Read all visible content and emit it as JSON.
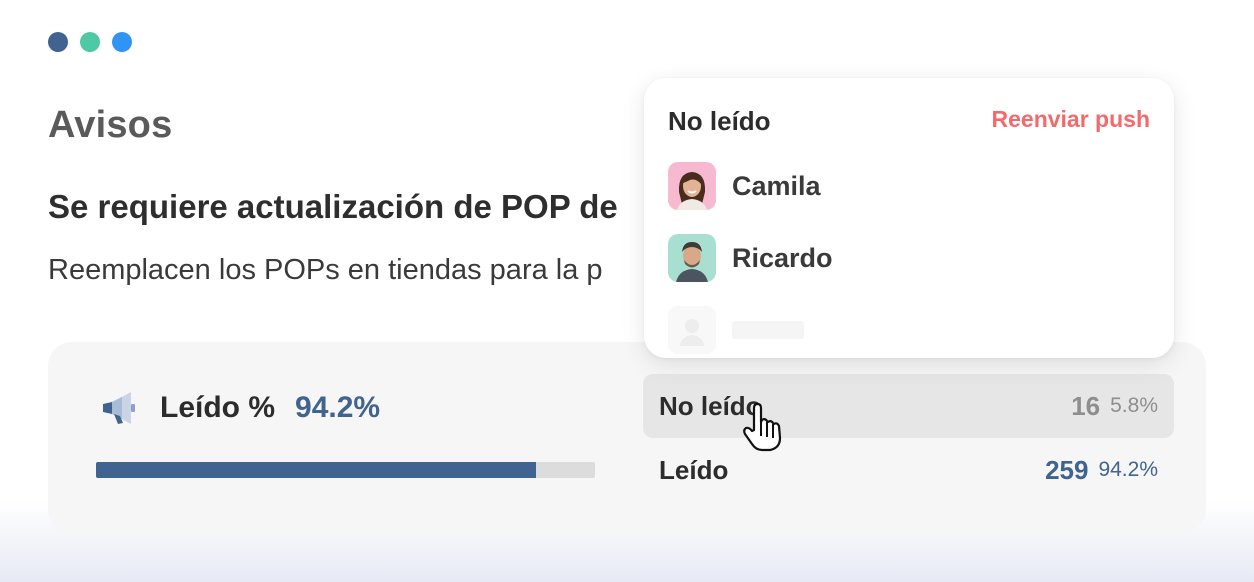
{
  "window": {
    "dot_colors": [
      "#41638f",
      "#4fc9a5",
      "#2f94f4"
    ]
  },
  "page": {
    "title": "Avisos",
    "headline": "Se requiere actualización de POP de",
    "subtitle": "Reemplacen los POPs en tiendas para la p"
  },
  "stats": {
    "icon": "megaphone-icon",
    "read_label": "Leído %",
    "read_percent_text": "94.2%",
    "progress_fraction": 0.882,
    "rows": [
      {
        "label": "No leído",
        "count": "16",
        "percent": "5.8%"
      },
      {
        "label": "Leído",
        "count": "259",
        "percent": "94.2%"
      }
    ]
  },
  "popover": {
    "title": "No leído",
    "action_label": "Reenviar push",
    "users": [
      {
        "name": "Camila"
      },
      {
        "name": "Ricardo"
      }
    ]
  },
  "colors": {
    "accent": "#41638f",
    "danger": "#f46a6a",
    "green": "#4fc9a5"
  }
}
